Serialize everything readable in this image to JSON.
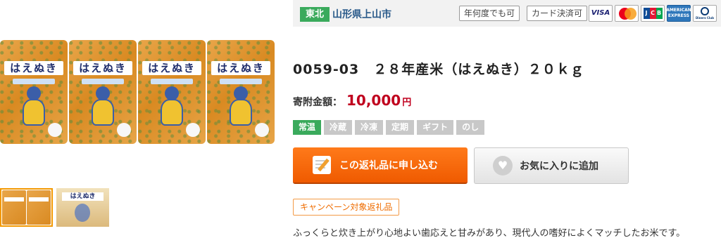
{
  "header": {
    "region": "東北",
    "municipality": "山形県上山市",
    "tags": [
      "年何度でも可",
      "カード決済可"
    ],
    "payment_cards": [
      "visa-card-icon",
      "mastercard-icon",
      "jcb-card-icon",
      "amex-card-icon",
      "diners-club-card-icon"
    ],
    "card_texts": {
      "visa": "VISA",
      "amex": "AMERICAN EXPRESS",
      "diners": "Diners Club",
      "jcb_j": "J",
      "jcb_c": "C",
      "jcb_b": "B"
    }
  },
  "gallery": {
    "bag_label": "はえぬき",
    "thumbnail_count": 2
  },
  "product": {
    "title": "0059-03　２８年産米（はえぬき）２０ｋｇ",
    "price_label": "寄附金額：",
    "price": "10,000",
    "price_unit": "円"
  },
  "temperature_tags": [
    {
      "label": "常温",
      "active": true
    },
    {
      "label": "冷蔵",
      "active": false
    },
    {
      "label": "冷凍",
      "active": false
    },
    {
      "label": "定期",
      "active": false
    },
    {
      "label": "ギフト",
      "active": false
    },
    {
      "label": "のし",
      "active": false
    }
  ],
  "actions": {
    "apply_label": "この返礼品に申し込む",
    "favorite_label": "お気に入りに追加"
  },
  "campaign_label": "キャンペーン対象返礼品",
  "description": "ふっくらと炊き上がり心地よい歯応えと甘みがあり、現代人の嗜好によくマッチしたお米です。",
  "colors": {
    "region_badge": "#3aaa5c",
    "price": "#c0001e",
    "apply_button": "#ef5a00",
    "campaign_border": "#f39a46"
  }
}
